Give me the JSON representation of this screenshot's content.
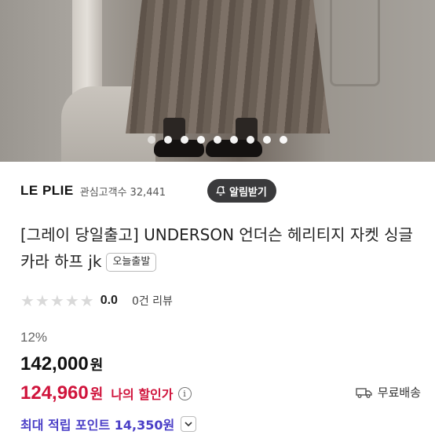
{
  "gallery": {
    "image_alt": "",
    "dots": [
      true,
      false,
      false,
      false,
      false,
      false,
      false,
      false,
      false
    ]
  },
  "store": {
    "brand": "LE PLIE",
    "followers_label": "관심고객수",
    "followers_count": "32,441",
    "notify_label": "알림받기",
    "notify_icon": "bell-plus-icon"
  },
  "product": {
    "title": "[그레이 당일출고] UNDERSON 언더슨 헤리티지 자켓 싱글 카라 하프 jk",
    "tag": "오늘출발"
  },
  "rating": {
    "stars": 0,
    "score": "0.0",
    "reviews": "0건 리뷰"
  },
  "price": {
    "discount": "12%",
    "original": "142,000",
    "original_unit": "원",
    "sale": "124,960",
    "sale_unit": "원",
    "my_price_label": "나의 할인가",
    "info_icon": "info-icon",
    "accent_color": "#d0143c"
  },
  "shipping": {
    "label": "무료배송",
    "icon": "truck-icon"
  },
  "points": {
    "label": "최대 적립 포인트 14,350원",
    "color": "#4a3ec7",
    "toggle_icon": "chevron-down-icon"
  }
}
